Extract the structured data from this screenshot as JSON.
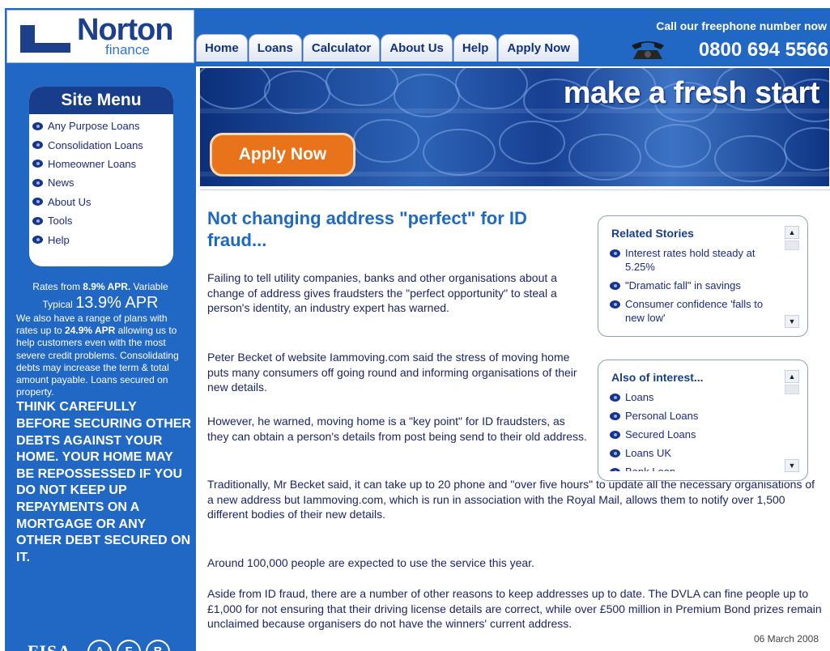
{
  "brand": {
    "name": "Norton",
    "sub": "finance"
  },
  "header": {
    "call_text": "Call our freephone number now",
    "phone": "0800 694 5566",
    "nav": [
      "Home",
      "Loans",
      "Calculator",
      "About Us",
      "Help",
      "Apply Now"
    ]
  },
  "banner": {
    "tagline": "make a fresh start",
    "apply_label": "Apply Now"
  },
  "site_menu": {
    "title": "Site Menu",
    "items": [
      "Any Purpose Loans",
      "Consolidation Loans",
      "Homeowner Loans",
      "News",
      "About Us",
      "Tools",
      "Help"
    ]
  },
  "rates": {
    "line1_prefix": "Rates from ",
    "line1_rate": "8.9% APR.",
    "line1_suffix": " Variable",
    "typical_label": "Typical ",
    "typical_rate": "13.9% APR",
    "body_a": "We also have a range of plans with rates up to ",
    "body_rate": "24.9% APR",
    "body_b": " allowing us to help customers even with the most severe credit problems. Consolidating debts may increase the term & total amount payable. Loans secured on property.",
    "warning": "THINK CAREFULLY BEFORE SECURING OTHER DEBTS AGAINST YOUR HOME. YOUR HOME MAY BE REPOSSESSED IF YOU DO NOT KEEP UP REPAYMENTS ON A MORTGAGE OR ANY OTHER DEBT SECURED ON IT."
  },
  "badges": {
    "fisa": "FISA",
    "letters": [
      "A",
      "F",
      "B"
    ]
  },
  "article": {
    "title": "Not changing address \"perfect\" for ID fraud...",
    "paragraphs": [
      "Failing to tell utility companies, banks and other organisations about a change of address gives fraudsters the \"perfect opportunity\" to steal a person's identity, an industry expert has warned.",
      "Peter Becket of website Iammoving.com said the stress of moving home puts many consumers off going round and informing organisations of their new details.",
      "However, he warned, moving home is a \"key point\" for ID fraudsters, as they can obtain a person's details from post being send to their old address.",
      "Traditionally, Mr Becket said, it can take up to 20 phone and \"over five hours\" to update all the necessary organisations of a new address but Iammoving.com, which is run in association with the Royal Mail, allows them to notify over 1,500 different bodies of their new details.",
      "Around 100,000 people are expected to use the service this year.",
      "Aside from ID fraud, there are a number of other reasons to keep addresses up to date. The DVLA can fine people up to £1,000 for not ensuring that their driving license details are correct, while over £500 million in Premium Bond prizes remain unclaimed because organisers do not have the winners' current address."
    ],
    "date": "06 March 2008"
  },
  "related": {
    "title": "Related Stories",
    "items": [
      "Interest rates hold steady at 5.25%",
      "\"Dramatic fall\" in savings",
      "Consumer confidence 'falls to new low'"
    ]
  },
  "also": {
    "title": "Also of interest...",
    "items": [
      "Loans",
      "Personal Loans",
      "Secured Loans",
      "Loans UK",
      "Bank Loan"
    ]
  },
  "colors": {
    "brand_blue": "#2167c4",
    "navy": "#173d8b",
    "title_blue": "#1d69c4",
    "orange": "#e9731a"
  }
}
